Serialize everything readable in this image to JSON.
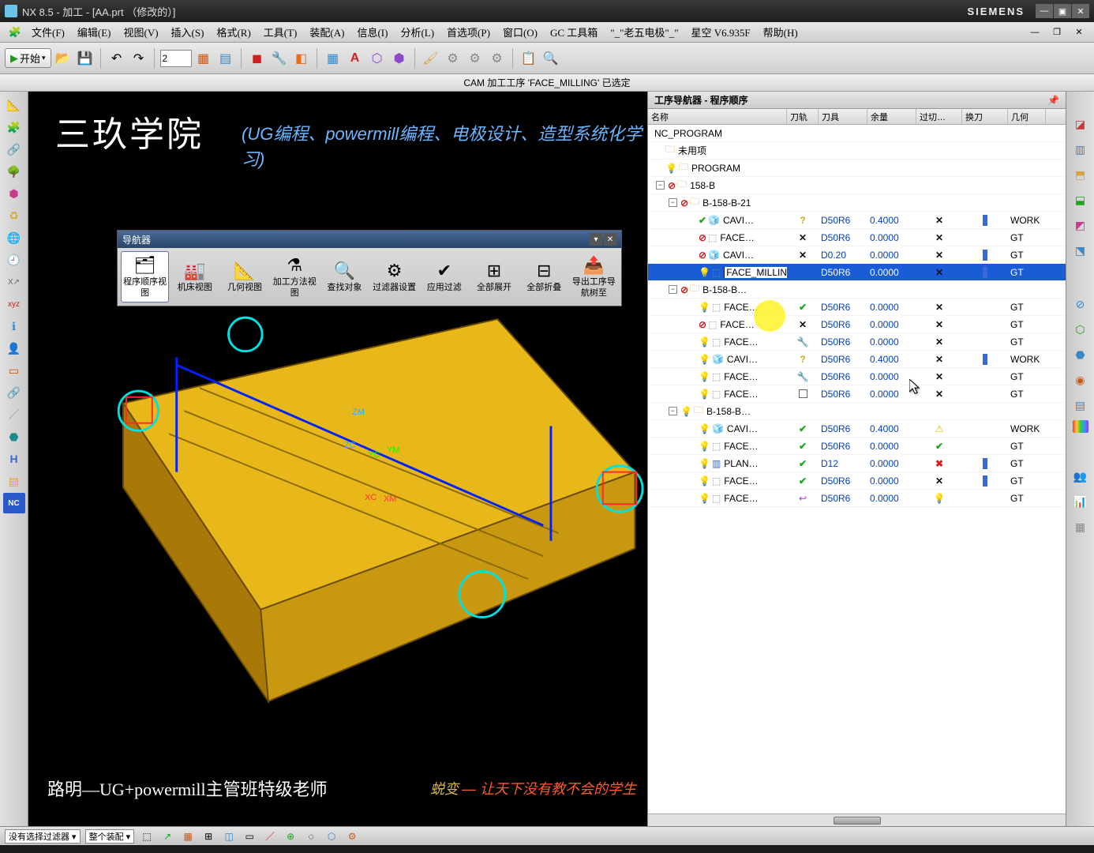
{
  "title": "NX 8.5 - 加工 - [AA.prt （修改的）]",
  "brand": "SIEMENS",
  "menus": [
    "文件(F)",
    "编辑(E)",
    "视图(V)",
    "插入(S)",
    "格式(R)",
    "工具(T)",
    "装配(A)",
    "信息(I)",
    "分析(L)",
    "首选项(P)",
    "窗口(O)",
    "GC 工具箱",
    "\"_\"老五电极\"_\"",
    "星空 V6.935F",
    "帮助(H)"
  ],
  "toolbar": {
    "start_label": "开始",
    "combo_value": "2"
  },
  "status_line": "CAM 加工工序 'FACE_MILLING' 已选定",
  "overlay": {
    "title": "三玖学院",
    "subtitle": "(UG编程、powermill编程、电极设计、造型系统化学习)",
    "bottom_left": "路明—UG+powermill主管班特级老师",
    "bottom_right_prefix": "蜕变",
    "bottom_right_rest": "— 让天下没有教不会的学生"
  },
  "csys": {
    "zm": "ZM",
    "zc": "ZC",
    "yc": "YC",
    "ym": "YM",
    "xc": "XC",
    "xm": "XM"
  },
  "nav_float": {
    "title": "导航器",
    "buttons": [
      "程序顺序视图",
      "机床视图",
      "几何视图",
      "加工方法视图",
      "查找对象",
      "过滤器设置",
      "应用过滤",
      "全部展开",
      "全部折叠",
      "导出工序导航树至"
    ]
  },
  "panel": {
    "title": "工序导航器 - 程序顺序",
    "columns": [
      "名称",
      "刀轨",
      "刀具",
      "余量",
      "过切…",
      "换刀",
      "几何"
    ],
    "rows": [
      {
        "indent": 6,
        "icon": "",
        "pre": "",
        "name": "NC_PROGRAM",
        "tool": "",
        "rest": "",
        "track": "",
        "cut": "",
        "chg": "",
        "geo": ""
      },
      {
        "indent": 22,
        "icon": "folder",
        "pre": "",
        "name": "未用项",
        "tool": "",
        "rest": "",
        "track": "",
        "cut": "",
        "chg": "",
        "geo": ""
      },
      {
        "indent": 22,
        "icon": "folder",
        "pre": "bulb",
        "name": "PROGRAM",
        "tool": "",
        "rest": "",
        "track": "",
        "cut": "",
        "chg": "",
        "geo": ""
      },
      {
        "indent": 10,
        "icon": "folder",
        "pre": "exp-ban",
        "name": "158-B",
        "tool": "",
        "rest": "",
        "track": "",
        "cut": "",
        "chg": "",
        "geo": ""
      },
      {
        "indent": 26,
        "icon": "folder",
        "pre": "exp-ban",
        "name": "B-158-B-21",
        "tool": "",
        "rest": "",
        "track": "",
        "cut": "",
        "chg": "",
        "geo": ""
      },
      {
        "indent": 64,
        "icon": "op-blue",
        "pre": "check",
        "name": "CAVI…",
        "tool": "D50R6",
        "rest": "0.4000",
        "track": "q",
        "cut": "x",
        "chg": "bar",
        "geo": "WORK"
      },
      {
        "indent": 64,
        "icon": "op-gray",
        "pre": "ban",
        "name": "FACE…",
        "tool": "D50R6",
        "rest": "0.0000",
        "track": "x",
        "cut": "x",
        "chg": "",
        "geo": "GT"
      },
      {
        "indent": 64,
        "icon": "op-blue",
        "pre": "ban",
        "name": "CAVI…",
        "tool": "D0.20",
        "rest": "0.0000",
        "track": "x",
        "cut": "x",
        "chg": "bar",
        "geo": "GT"
      },
      {
        "indent": 64,
        "icon": "op-gray",
        "pre": "bulb",
        "name": "FACE_MILLING",
        "tool": "D50R6",
        "rest": "0.0000",
        "track": "",
        "cut": "x",
        "chg": "bar",
        "geo": "GT",
        "selected": true,
        "namebox": true
      },
      {
        "indent": 26,
        "icon": "folder",
        "pre": "exp-ban",
        "name": "B-158-B…",
        "tool": "",
        "rest": "",
        "track": "",
        "cut": "",
        "chg": "",
        "geo": ""
      },
      {
        "indent": 64,
        "icon": "op-gray",
        "pre": "bulb",
        "name": "FACE…",
        "tool": "D50R6",
        "rest": "0.0000",
        "track": "check",
        "cut": "x",
        "chg": "",
        "geo": "GT"
      },
      {
        "indent": 64,
        "icon": "op-gray",
        "pre": "ban",
        "name": "FACE…",
        "tool": "D50R6",
        "rest": "0.0000",
        "track": "x",
        "cut": "x",
        "chg": "",
        "geo": "GT"
      },
      {
        "indent": 64,
        "icon": "op-gray",
        "pre": "bulb",
        "name": "FACE…",
        "tool": "D50R6",
        "rest": "0.0000",
        "track": "wrench",
        "cut": "x",
        "chg": "",
        "geo": "GT"
      },
      {
        "indent": 64,
        "icon": "op-blue",
        "pre": "bulb",
        "name": "CAVI…",
        "tool": "D50R6",
        "rest": "0.4000",
        "track": "q",
        "cut": "x",
        "chg": "bar",
        "geo": "WORK"
      },
      {
        "indent": 64,
        "icon": "op-gray",
        "pre": "bulb",
        "name": "FACE…",
        "tool": "D50R6",
        "rest": "0.0000",
        "track": "wrench",
        "cut": "x",
        "chg": "",
        "geo": "GT"
      },
      {
        "indent": 64,
        "icon": "op-gray",
        "pre": "bulb",
        "name": "FACE…",
        "tool": "D50R6",
        "rest": "0.0000",
        "track": "sq",
        "cut": "x",
        "chg": "",
        "geo": "GT"
      },
      {
        "indent": 26,
        "icon": "folder",
        "pre": "exp-bulb",
        "name": "B-158-B…",
        "tool": "",
        "rest": "",
        "track": "",
        "cut": "",
        "chg": "",
        "geo": ""
      },
      {
        "indent": 64,
        "icon": "op-blue",
        "pre": "bulb",
        "name": "CAVI…",
        "tool": "D50R6",
        "rest": "0.4000",
        "track": "check",
        "cut": "warn",
        "chg": "",
        "geo": "WORK"
      },
      {
        "indent": 64,
        "icon": "op-gray",
        "pre": "bulb",
        "name": "FACE…",
        "tool": "D50R6",
        "rest": "0.0000",
        "track": "check",
        "cut": "check",
        "chg": "",
        "geo": "GT"
      },
      {
        "indent": 64,
        "icon": "op-plan",
        "pre": "bulb",
        "name": "PLAN…",
        "tool": "D12",
        "rest": "0.0000",
        "track": "check",
        "cut": "red-x",
        "chg": "bar",
        "geo": "GT"
      },
      {
        "indent": 64,
        "icon": "op-gray",
        "pre": "bulb",
        "name": "FACE…",
        "tool": "D50R6",
        "rest": "0.0000",
        "track": "check",
        "cut": "x",
        "chg": "bar",
        "geo": "GT"
      },
      {
        "indent": 64,
        "icon": "op-gray",
        "pre": "bulb",
        "name": "FACE…",
        "tool": "D50R6",
        "rest": "0.0000",
        "track": "purple",
        "cut": "bulb",
        "chg": "",
        "geo": "GT"
      }
    ]
  },
  "bottombar": {
    "filter_label": "没有选择过滤器",
    "assembly_label": "整个装配"
  }
}
